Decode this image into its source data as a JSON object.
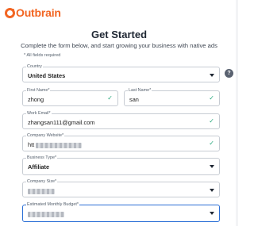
{
  "brand": {
    "logo_text": "Outbrain",
    "accent": "#f26522"
  },
  "form": {
    "title": "Get Started",
    "subtitle": "Complete the form below, and start growing your business with native ads",
    "required_note": "* All fields required",
    "country": {
      "label": "Country",
      "value": "United States"
    },
    "first_name": {
      "label": "First Name*",
      "value": "zhong"
    },
    "last_name": {
      "label": "Last Name*",
      "value": "san"
    },
    "work_email": {
      "label": "Work Email*",
      "value": "zhangsan111@gmail.com"
    },
    "company_website": {
      "label": "Company Website*",
      "value": "htt"
    },
    "business_type": {
      "label": "Business Type*",
      "value": "Affiliate"
    },
    "company_size": {
      "label": "Company Size*",
      "value": ""
    },
    "monthly_budget": {
      "label": "Estimated Monthly Budget*",
      "value": ""
    },
    "help_glyph": "?"
  },
  "colors": {
    "valid": "#27a87d",
    "focus": "#2b6fd6",
    "text": "#1f2733"
  },
  "icons": {
    "valid": "check-icon",
    "dropdown": "chevron-down-icon",
    "help": "help-icon"
  }
}
